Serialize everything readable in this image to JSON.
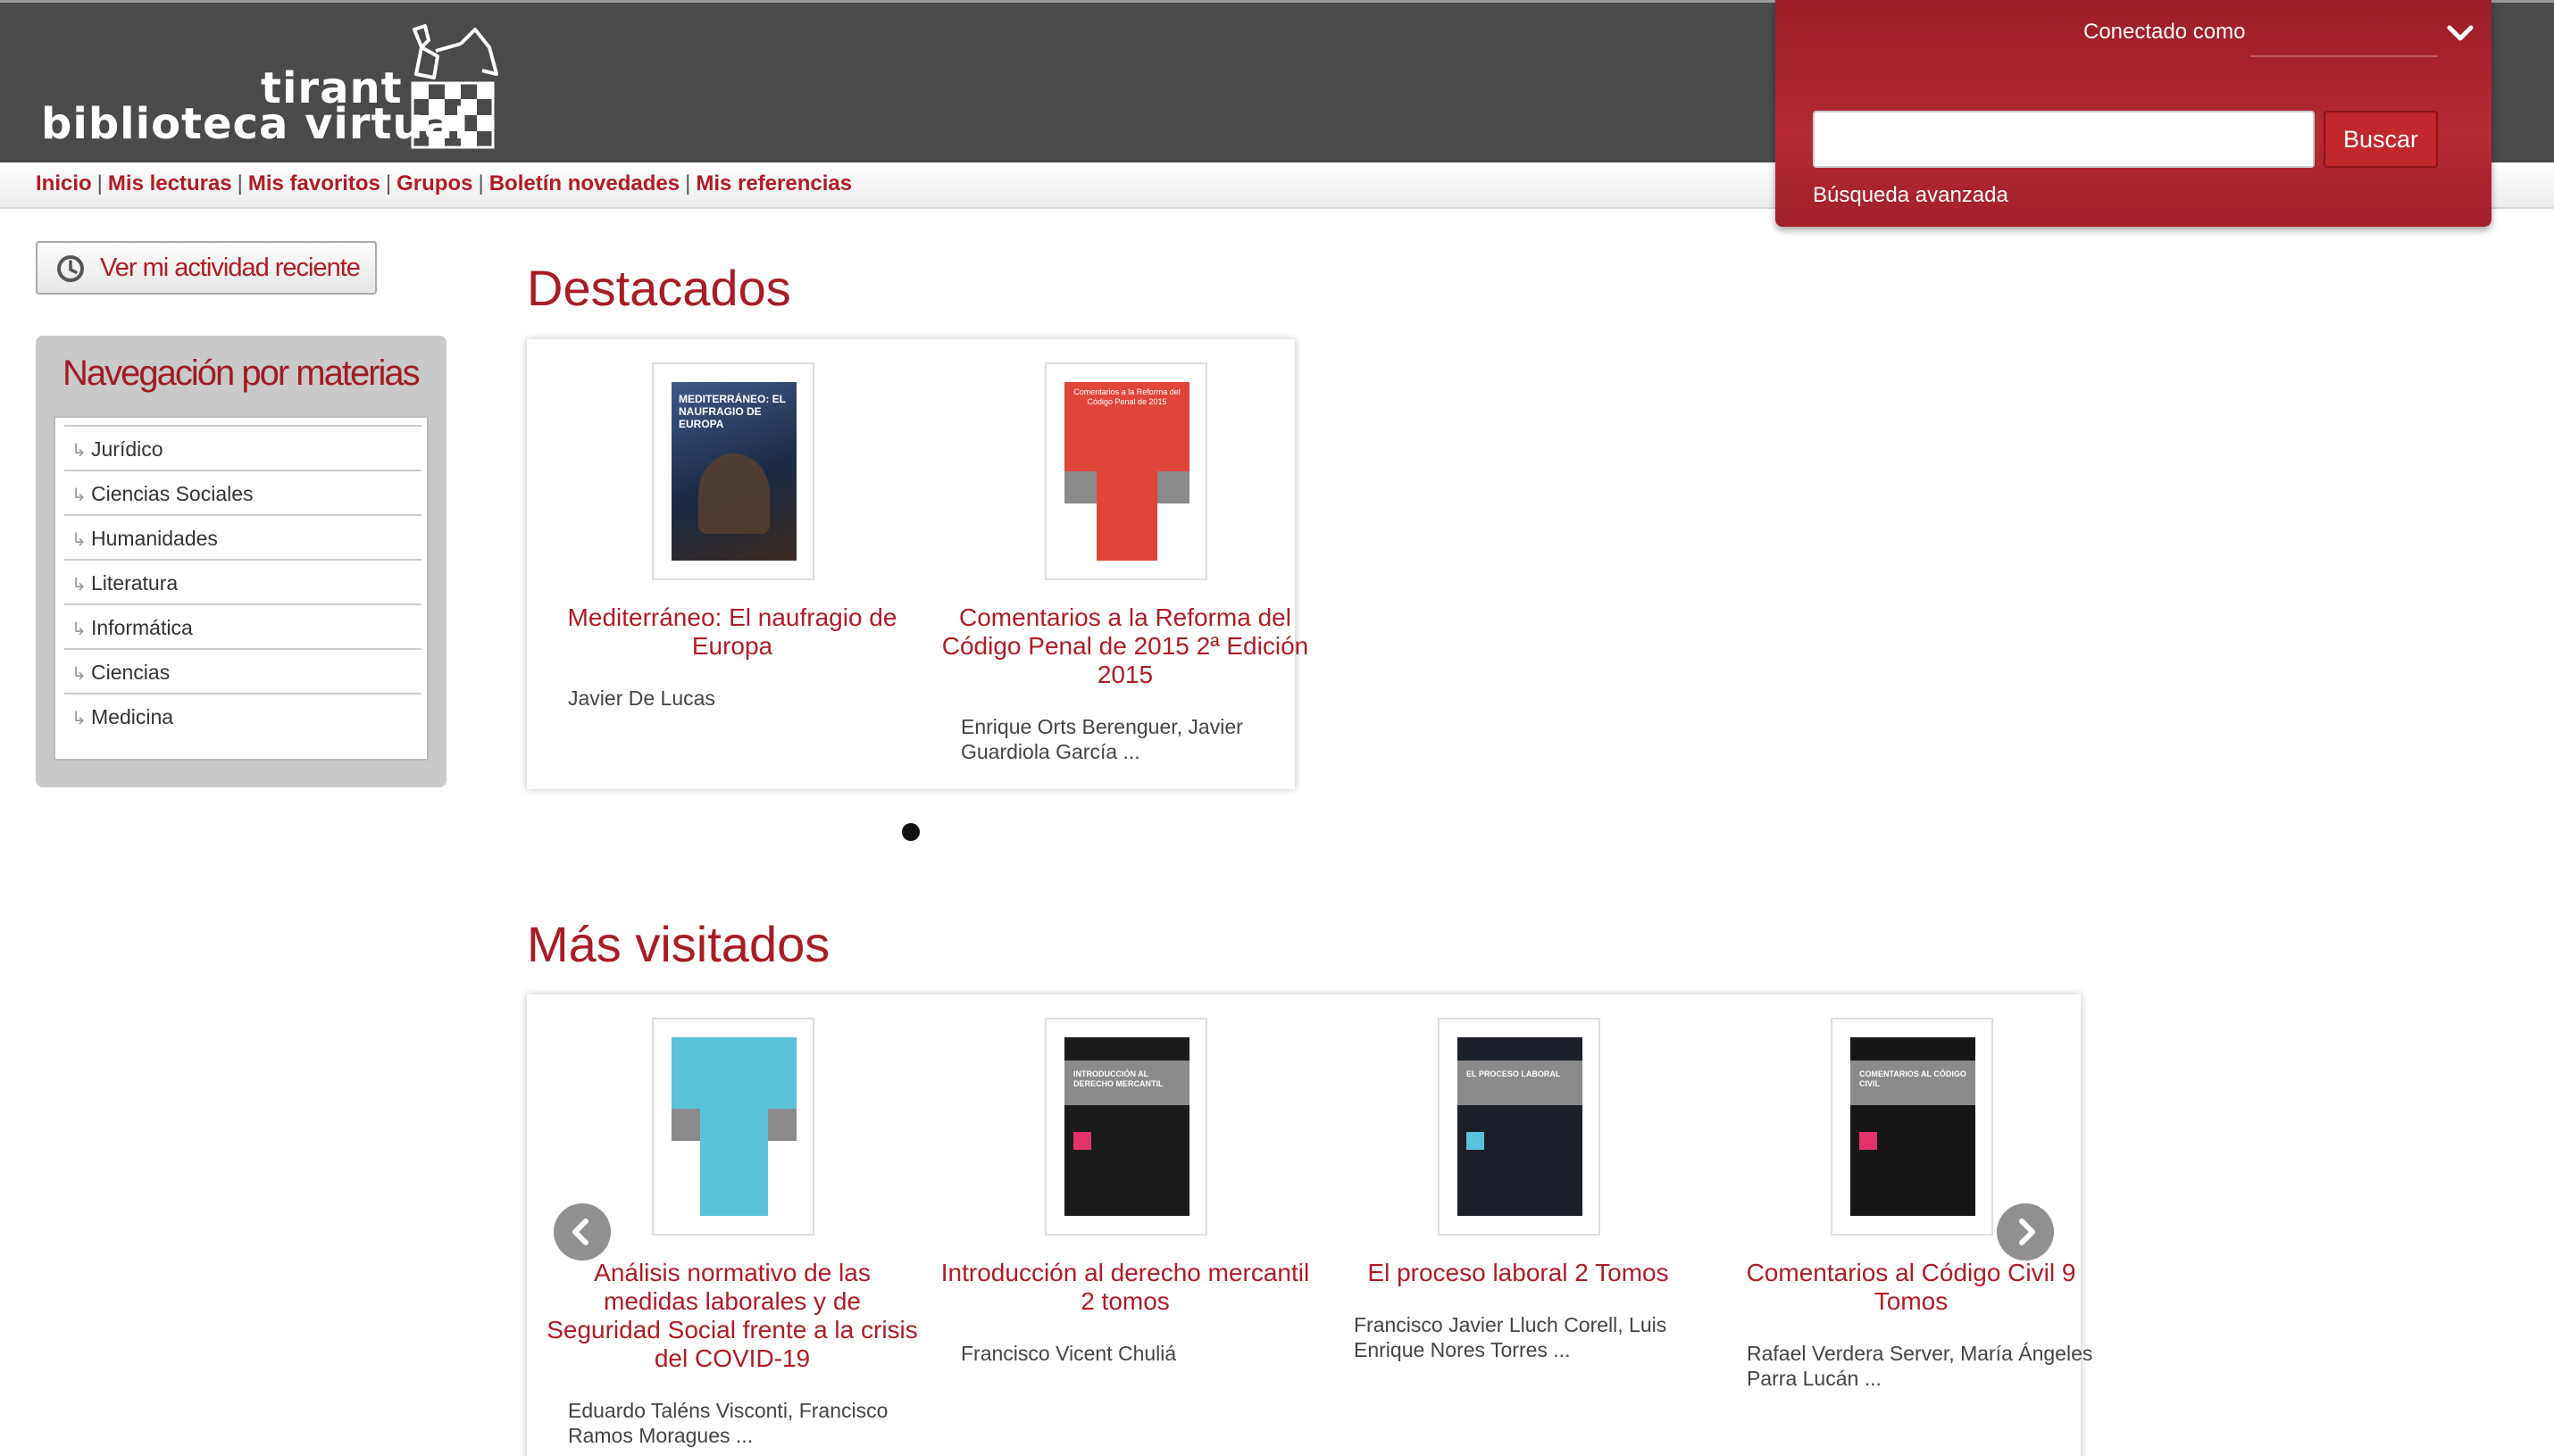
{
  "brand": {
    "line1": "tirant",
    "line2": "biblioteca virtual"
  },
  "nav": {
    "links": [
      "Inicio",
      "Mis lecturas",
      "Mis favoritos",
      "Grupos",
      "Boletín novedades",
      "Mis referencias"
    ]
  },
  "account": {
    "connected_label": "Conectado como",
    "search_placeholder": "",
    "search_button": "Buscar",
    "advanced_search": "Búsqueda avanzada"
  },
  "activity": {
    "label": "Ver mi actividad reciente"
  },
  "subjects": {
    "title": "Navegación por materias",
    "items": [
      "Jurídico",
      "Ciencias Sociales",
      "Humanidades",
      "Literatura",
      "Informática",
      "Ciencias",
      "Medicina"
    ]
  },
  "featured": {
    "title": "Destacados",
    "books": [
      {
        "title": "Mediterráneo: El naufragio de Europa",
        "author": "Javier De Lucas",
        "cover_text": "MEDITERRÁNEO: EL NAUFRAGIO DE EUROPA",
        "cover_color": "#2c3f63"
      },
      {
        "title": "Comentarios a la Reforma del Código Penal de 2015 2ª Edición 2015",
        "author": "Enrique Orts Berenguer, Javier Guardiola García ...",
        "cover_text": "Comentarios a la Reforma del Código Penal de 2015",
        "cover_color": "#e0453a"
      }
    ]
  },
  "most_visited": {
    "title": "Más visitados",
    "books": [
      {
        "title": "Análisis normativo de las medidas laborales y de Seguridad Social frente a la crisis del COVID-19",
        "author": "Eduardo Taléns Visconti, Francisco Ramos Moragues ...",
        "cover_color": "#5bc2dc"
      },
      {
        "title": "Introducción al derecho mercantil 2 tomos",
        "author": "Francisco Vicent Chuliá",
        "cover_text": "INTRODUCCIÓN AL DERECHO MERCANTIL",
        "cover_color": "#1b1b1b"
      },
      {
        "title": "El proceso laboral 2 Tomos",
        "author": "Francisco Javier Lluch Corell, Luis Enrique Nores Torres ...",
        "cover_text": "EL PROCESO LABORAL",
        "cover_color": "#1b1f2a"
      },
      {
        "title": "Comentarios al Código Civil 9 Tomos",
        "author": "Rafael Verdera Server, María Ángeles Parra Lucán ...",
        "cover_text": "COMENTARIOS AL CÓDIGO CIVIL",
        "cover_color": "#161616"
      }
    ]
  },
  "colors": {
    "accent": "#b01c24",
    "header_bg": "#4a4a4a",
    "panel_bg": "#b52a35"
  }
}
